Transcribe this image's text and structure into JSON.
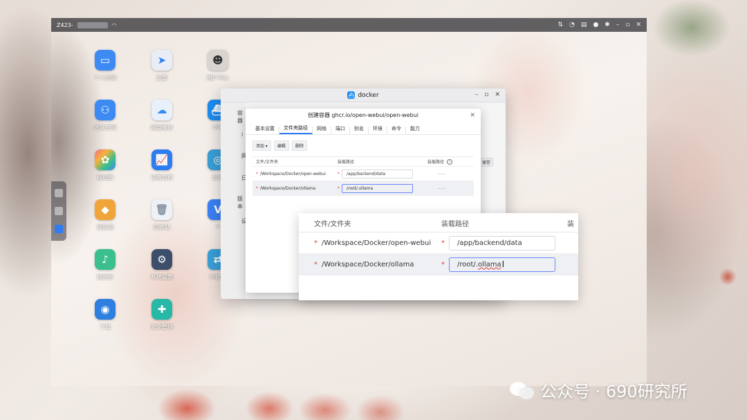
{
  "topbar": {
    "host": "Z423-",
    "right_icons": [
      "sort-icon",
      "headset-icon",
      "message-icon",
      "user-icon",
      "settings-icon",
      "minimize-icon",
      "maximize-icon",
      "close-icon"
    ]
  },
  "apps": [
    {
      "label": "个人空间",
      "icon": "folder-icon",
      "color": "#3d8bf2"
    },
    {
      "label": "迅雷",
      "icon": "xunlei-icon",
      "color": "#e9eef6"
    },
    {
      "label": "用户中心",
      "icon": "user-avatar-icon",
      "color": "#d9d4cf"
    },
    {
      "label": "团队空间",
      "icon": "team-folder-icon",
      "color": "#3d8bf2"
    },
    {
      "label": "网盘备份",
      "icon": "cloud-backup-icon",
      "color": "#2f8ef0"
    },
    {
      "label": "doc",
      "icon": "docker-icon",
      "color": "#1d8cf0"
    },
    {
      "label": "极相册",
      "icon": "photos-icon",
      "color": "#f26c8a"
    },
    {
      "label": "设备监控",
      "icon": "monitor-icon",
      "color": "#2d7cf0"
    },
    {
      "label": "远程",
      "icon": "remote-icon",
      "color": "#3aa0d8"
    },
    {
      "label": "极影视",
      "icon": "video-icon",
      "color": "#f0a53b"
    },
    {
      "label": "回收站",
      "icon": "trash-icon",
      "color": "#d6dbe2"
    },
    {
      "label": "V",
      "icon": "vm-icon",
      "color": "#3b82f6"
    },
    {
      "label": "极音乐",
      "icon": "music-icon",
      "color": "#3bbf8c"
    },
    {
      "label": "系统设置",
      "icon": "settings-icon",
      "color": "#3d4e6a"
    },
    {
      "label": "中转站",
      "icon": "transfer-icon",
      "color": "#3aa0d8"
    },
    {
      "label": "下载",
      "icon": "download-globe-icon",
      "color": "#2e7fe0"
    },
    {
      "label": "安全管理",
      "icon": "security-icon",
      "color": "#27b8a6"
    }
  ],
  "docker": {
    "title": "docker",
    "sidebar": [
      "容器",
      "i",
      "网",
      "日",
      "版本",
      "设"
    ]
  },
  "dialog": {
    "title": "创建容器 ghcr.io/open-webui/open-webui",
    "tabs": [
      "基本设置",
      "文件夹路径",
      "网络",
      "端口",
      "别名",
      "环境",
      "命令",
      "能力"
    ],
    "active_tab": "文件夹路径",
    "toolbar": {
      "add": "添加 ▾",
      "edit": "编辑",
      "delete": "删除"
    },
    "columns": [
      "文件/文件夹",
      "装载路径",
      "装载路径"
    ],
    "rows": [
      {
        "folder": "/Workspace/Docker/open-webui",
        "mount": "/app/backend/data",
        "extra": "——"
      },
      {
        "folder": "/Workspace/Docker/ollama",
        "mount": "/root/.ollama",
        "extra": "——"
      }
    ],
    "side_button": "保存"
  },
  "zoom": {
    "columns": [
      "文件/文件夹",
      "装载路径",
      "装"
    ],
    "rows": [
      {
        "folder": "/Workspace/Docker/open-webui",
        "mount": "/app/backend/data"
      },
      {
        "folder": "/Workspace/Docker/ollama",
        "mount_prefix": "/root/.",
        "mount_suffix": "ollama"
      }
    ]
  },
  "watermark": "公众号 · 690研究所"
}
